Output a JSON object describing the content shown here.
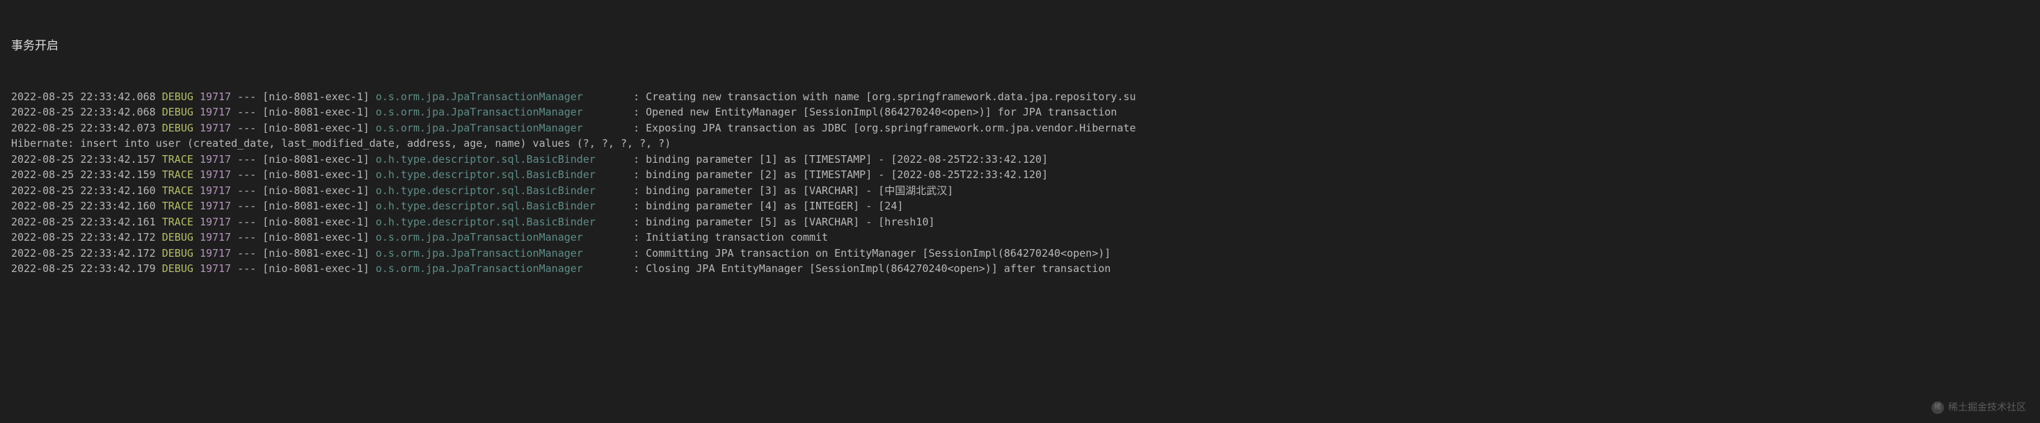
{
  "header": "事务开启",
  "colors": {
    "background": "#1e1e1e",
    "text": "#b8b8b8",
    "level": "#b5bd68",
    "pid": "#b294bb",
    "logger": "#5e8d87"
  },
  "lines": [
    {
      "type": "log",
      "timestamp": "2022-08-25 22:33:42.068",
      "level": "DEBUG",
      "pid": "19717",
      "thread": "[nio-8081-exec-1]",
      "logger": "o.s.orm.jpa.JpaTransactionManager       ",
      "message": ": Creating new transaction with name [org.springframework.data.jpa.repository.su"
    },
    {
      "type": "log",
      "timestamp": "2022-08-25 22:33:42.068",
      "level": "DEBUG",
      "pid": "19717",
      "thread": "[nio-8081-exec-1]",
      "logger": "o.s.orm.jpa.JpaTransactionManager       ",
      "message": ": Opened new EntityManager [SessionImpl(864270240<open>)] for JPA transaction"
    },
    {
      "type": "log",
      "timestamp": "2022-08-25 22:33:42.073",
      "level": "DEBUG",
      "pid": "19717",
      "thread": "[nio-8081-exec-1]",
      "logger": "o.s.orm.jpa.JpaTransactionManager       ",
      "message": ": Exposing JPA transaction as JDBC [org.springframework.orm.jpa.vendor.Hibernate"
    },
    {
      "type": "plain",
      "text": "Hibernate: insert into user (created_date, last_modified_date, address, age, name) values (?, ?, ?, ?, ?)"
    },
    {
      "type": "log",
      "timestamp": "2022-08-25 22:33:42.157",
      "level": "TRACE",
      "pid": "19717",
      "thread": "[nio-8081-exec-1]",
      "logger": "o.h.type.descriptor.sql.BasicBinder     ",
      "message": ": binding parameter [1] as [TIMESTAMP] - [2022-08-25T22:33:42.120]"
    },
    {
      "type": "log",
      "timestamp": "2022-08-25 22:33:42.159",
      "level": "TRACE",
      "pid": "19717",
      "thread": "[nio-8081-exec-1]",
      "logger": "o.h.type.descriptor.sql.BasicBinder     ",
      "message": ": binding parameter [2] as [TIMESTAMP] - [2022-08-25T22:33:42.120]"
    },
    {
      "type": "log",
      "timestamp": "2022-08-25 22:33:42.160",
      "level": "TRACE",
      "pid": "19717",
      "thread": "[nio-8081-exec-1]",
      "logger": "o.h.type.descriptor.sql.BasicBinder     ",
      "message": ": binding parameter [3] as [VARCHAR] - [中国湖北武汉]"
    },
    {
      "type": "log",
      "timestamp": "2022-08-25 22:33:42.160",
      "level": "TRACE",
      "pid": "19717",
      "thread": "[nio-8081-exec-1]",
      "logger": "o.h.type.descriptor.sql.BasicBinder     ",
      "message": ": binding parameter [4] as [INTEGER] - [24]"
    },
    {
      "type": "log",
      "timestamp": "2022-08-25 22:33:42.161",
      "level": "TRACE",
      "pid": "19717",
      "thread": "[nio-8081-exec-1]",
      "logger": "o.h.type.descriptor.sql.BasicBinder     ",
      "message": ": binding parameter [5] as [VARCHAR] - [hresh10]"
    },
    {
      "type": "log",
      "timestamp": "2022-08-25 22:33:42.172",
      "level": "DEBUG",
      "pid": "19717",
      "thread": "[nio-8081-exec-1]",
      "logger": "o.s.orm.jpa.JpaTransactionManager       ",
      "message": ": Initiating transaction commit"
    },
    {
      "type": "log",
      "timestamp": "2022-08-25 22:33:42.172",
      "level": "DEBUG",
      "pid": "19717",
      "thread": "[nio-8081-exec-1]",
      "logger": "o.s.orm.jpa.JpaTransactionManager       ",
      "message": ": Committing JPA transaction on EntityManager [SessionImpl(864270240<open>)]"
    },
    {
      "type": "log",
      "timestamp": "2022-08-25 22:33:42.179",
      "level": "DEBUG",
      "pid": "19717",
      "thread": "[nio-8081-exec-1]",
      "logger": "o.s.orm.jpa.JpaTransactionManager       ",
      "message": ": Closing JPA EntityManager [SessionImpl(864270240<open>)] after transaction"
    }
  ],
  "watermark": {
    "text": "稀土掘金技术社区",
    "icon": "稀"
  }
}
